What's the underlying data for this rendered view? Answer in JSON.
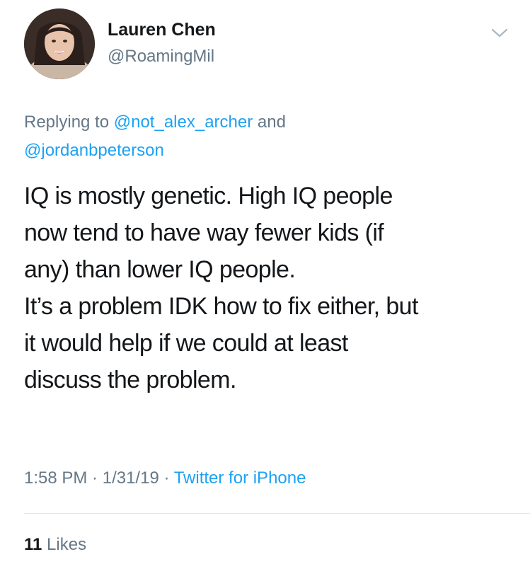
{
  "author": {
    "display_name": "Lauren Chen",
    "handle": "@RoamingMil",
    "avatar_icon": "profile-photo"
  },
  "reply": {
    "prefix": "Replying to ",
    "mentions": [
      "@not_alex_archer",
      "@jordanbpeterson"
    ],
    "joiner": " and"
  },
  "tweet": {
    "lines": [
      "IQ is mostly genetic. High IQ people",
      "now tend to have way fewer kids (if",
      "any) than lower IQ people.",
      "It’s a problem IDK how to fix either, but",
      "it would help if we could at least",
      "discuss the problem."
    ]
  },
  "meta": {
    "time": "1:58 PM",
    "separator": " · ",
    "date": "1/31/19",
    "source": "Twitter for iPhone"
  },
  "engagement": {
    "likes_count": "11",
    "likes_label": " Likes"
  },
  "colors": {
    "text": "#14171a",
    "secondary": "#657786",
    "link": "#1da1f2",
    "divider": "#e1e8ed"
  },
  "icons": {
    "menu": "chevron-down-icon"
  }
}
